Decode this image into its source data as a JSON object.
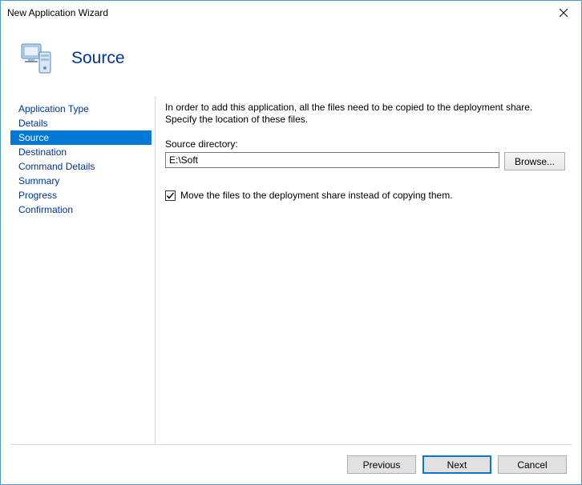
{
  "window": {
    "title": "New Application Wizard"
  },
  "header": {
    "page_title": "Source"
  },
  "sidebar": {
    "items": [
      {
        "label": "Application Type",
        "selected": false
      },
      {
        "label": "Details",
        "selected": false
      },
      {
        "label": "Source",
        "selected": true
      },
      {
        "label": "Destination",
        "selected": false
      },
      {
        "label": "Command Details",
        "selected": false
      },
      {
        "label": "Summary",
        "selected": false
      },
      {
        "label": "Progress",
        "selected": false
      },
      {
        "label": "Confirmation",
        "selected": false
      }
    ]
  },
  "main": {
    "instruction": "In order to add this application, all the files need to be copied to the deployment share.   Specify the location of these files.",
    "source_directory_label": "Source directory:",
    "source_directory_value": "E:\\Soft",
    "browse_label": "Browse...",
    "move_files_checked": true,
    "move_files_label": "Move the files to the deployment share instead of copying them."
  },
  "footer": {
    "previous": "Previous",
    "next": "Next",
    "cancel": "Cancel"
  }
}
